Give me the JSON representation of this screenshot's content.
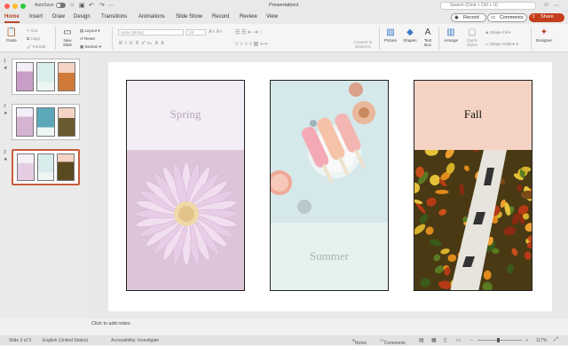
{
  "window": {
    "title": "Presentation1",
    "autosave": "AutoSave",
    "search_placeholder": "Search (Cmd + Ctrl + U)"
  },
  "colors": {
    "accent": "#b7472a",
    "share": "#c43e1c",
    "close": "#ff5f57",
    "minimize": "#febc2e",
    "maximize": "#28c840",
    "fall_title_bg": "#f4d3c4",
    "spring_title_bg": "#f3eef5",
    "spring_bg": "#dcc5d9",
    "summer_bg": "#e6f2f0"
  },
  "tabs": [
    "Home",
    "Insert",
    "Draw",
    "Design",
    "Transitions",
    "Animations",
    "Slide Show",
    "Record",
    "Review",
    "View"
  ],
  "actions": {
    "record": "Record",
    "comments": "Comments",
    "share": "Share"
  },
  "ribbon": {
    "paste": "Paste",
    "cut": "Cut",
    "copy": "Copy",
    "format": "Format",
    "new_slide": "New Slide",
    "layout": "Layout",
    "reset": "Reset",
    "section": "Section",
    "font_name": "Aptos (Body)",
    "font_size": "18",
    "convert_smartart": "Convert to SmartArt",
    "picture": "Picture",
    "shapes": "Shapes",
    "text_box": "Text Box",
    "arrange": "Arrange",
    "quick_styles": "Quick Styles",
    "shape_fill": "Shape Fill",
    "shape_outline": "Shape Outline",
    "designer": "Designer"
  },
  "slides": [
    {
      "number": "1",
      "star": "★"
    },
    {
      "number": "2",
      "star": "★"
    },
    {
      "number": "3",
      "star": "★"
    }
  ],
  "slide": {
    "panels": [
      {
        "title": "Spring"
      },
      {
        "title": "Summer"
      },
      {
        "title": "Fall"
      }
    ]
  },
  "notes_placeholder": "Click to add notes",
  "status": {
    "slide": "Slide 3 of 3",
    "language": "English (United States)",
    "accessibility": "Accessibility: Investigate",
    "notes": "Notes",
    "comments": "Comments",
    "zoom": "117%"
  },
  "icons": [
    "close-dot",
    "minimize-dot",
    "maximize-dot",
    "home-icon",
    "save-icon",
    "undo-icon",
    "redo-icon",
    "search-icon",
    "record-icon",
    "comments-icon",
    "share-icon",
    "paste-icon",
    "new-slide-icon",
    "picture-icon",
    "shapes-icon",
    "text-box-icon",
    "arrange-icon",
    "quick-styles-icon",
    "designer-icon",
    "daisy-image",
    "popsicle-image",
    "leaves-image"
  ]
}
